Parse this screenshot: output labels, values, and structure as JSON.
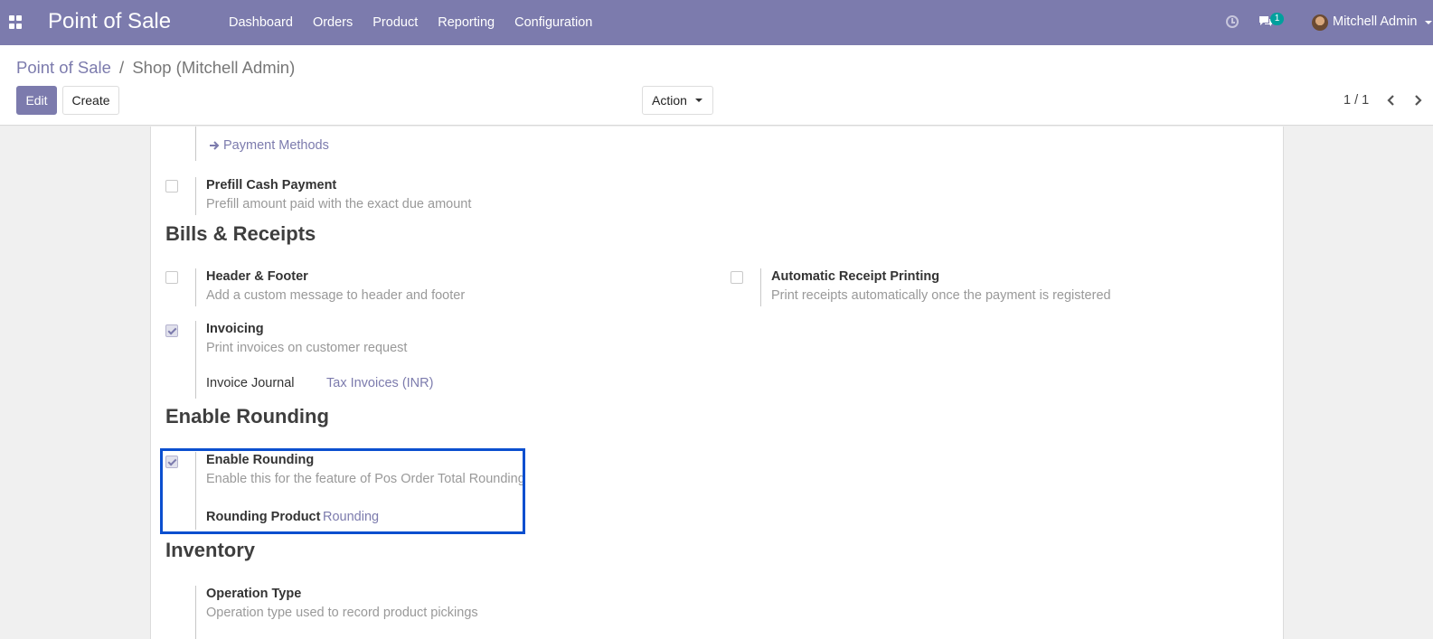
{
  "navbar": {
    "brand": "Point of Sale",
    "menu": [
      "Dashboard",
      "Orders",
      "Product",
      "Reporting",
      "Configuration"
    ],
    "chat_count": "1",
    "user_name": "Mitchell Admin"
  },
  "control_panel": {
    "breadcrumb_parent": "Point of Sale",
    "breadcrumb_separator": "/",
    "breadcrumb_current": "Shop (Mitchell Admin)",
    "edit_label": "Edit",
    "create_label": "Create",
    "action_label": "Action",
    "pager": "1 / 1"
  },
  "settings": {
    "payment_methods_link": "Payment Methods",
    "prefill_cash": {
      "title": "Prefill Cash Payment",
      "desc": "Prefill amount paid with the exact due amount",
      "checked": false
    },
    "bills_section": "Bills & Receipts",
    "header_footer": {
      "title": "Header & Footer",
      "desc": "Add a custom message to header and footer",
      "checked": false
    },
    "auto_receipt": {
      "title": "Automatic Receipt Printing",
      "desc": "Print receipts automatically once the payment is registered",
      "checked": false
    },
    "invoicing": {
      "title": "Invoicing",
      "desc": "Print invoices on customer request",
      "checked": true,
      "journal_label": "Invoice Journal",
      "journal_value": "Tax Invoices (INR)"
    },
    "rounding_section": "Enable Rounding",
    "enable_rounding": {
      "title": "Enable Rounding",
      "desc": "Enable this for the feature of Pos Order Total Rounding",
      "checked": true,
      "product_label": "Rounding Product",
      "product_value": "Rounding"
    },
    "inventory_section": "Inventory",
    "operation_type": {
      "title": "Operation Type",
      "desc": "Operation type used to record product pickings"
    }
  },
  "colors": {
    "brand": "#7c7bad",
    "highlight": "#0b4fcf",
    "badge": "#00a09d"
  }
}
